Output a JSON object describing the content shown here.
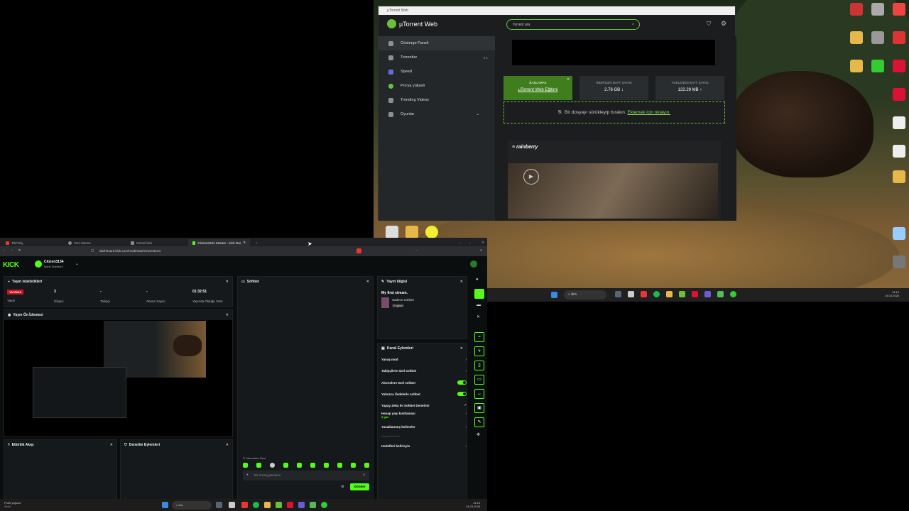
{
  "utorrent": {
    "window_title": "µTorrent Web",
    "logo": "µTorrent Web",
    "search_placeholder": "Torrent ara",
    "sidebar": [
      {
        "label": "Gösterge Paneli",
        "icon": "dashboard-icon"
      },
      {
        "label": "Torrentler",
        "icon": "torrents-icon",
        "badge": "0  1"
      },
      {
        "label": "Speed",
        "icon": "speed-icon"
      },
      {
        "label": "Pro'ya yükselt",
        "icon": "pro-icon"
      },
      {
        "label": "Trending Videos",
        "icon": "video-icon"
      },
      {
        "label": "Oyunlar",
        "icon": "games-icon"
      }
    ],
    "start_card": {
      "title": "BAŞLAMAK",
      "link": "µTorrent Web Eğitimi"
    },
    "download_card": {
      "title": "İNDİRİLEN BAYT SAYISI",
      "value": "2.76 GB ↓"
    },
    "upload_card": {
      "title": "YÜKLENEN BAYT SAYISI",
      "value": "122.29 MB ↑"
    },
    "drop_text": "Bir dosyayı sürükleyip bırakın.",
    "drop_link": "Eklemek için tıklayın.",
    "rainberry": "rainberry"
  },
  "desktop_taskbar": {
    "search": "Ara",
    "time": "14:13",
    "date": "24.03.2026"
  },
  "browser": {
    "tabs": [
      "TikFinity",
      "Yeni Sekme",
      "Görsel kick",
      "Clozen3134 Stream - Kick Dash"
    ],
    "url": "dashboard.kick.com/moderator/clozen3134"
  },
  "kick": {
    "logo": "KICK",
    "user": "Clozen3134",
    "user_role": "İçerik Direktörü",
    "stats_title": "Yayın istatistikleri",
    "stats": [
      {
        "value": "YAYINDA",
        "label": "Yayın"
      },
      {
        "value": "3",
        "label": "İzleyici"
      },
      {
        "value": "-",
        "label": "Takipçi"
      },
      {
        "value": "-",
        "label": "Abone Sayısı"
      },
      {
        "value": "01:32:51",
        "label": "Yayında Olduğu Süre"
      }
    ],
    "preview_title": "Yayın Ön İzlemesi",
    "activity_title": "Etkinlik Akışı",
    "moderation_title": "Denetim Eylemleri",
    "chat_title": "Sohbet",
    "chat_sub_label": "Abonelere Özel",
    "chat_placeholder": "Bir mesaj gönderin",
    "send_label": "Gönder",
    "info_title": "Yayın bilgisi",
    "stream_title": "My first stream.",
    "category": "Sadece Sohbet",
    "language": "English",
    "channel_title": "Kanal Eylemleri",
    "channel_actions": [
      {
        "label": "Yavaş mod",
        "type": "chevron"
      },
      {
        "label": "Takipçilere özel sohbet",
        "type": "chevron"
      },
      {
        "label": "Abonelere özel sohbet",
        "type": "toggle"
      },
      {
        "label": "Yalnızca ifadelerle sohbet",
        "type": "toggle"
      },
      {
        "label": "Yapay Zeka ile Sohbet Denetimi",
        "type": "link"
      },
      {
        "label": "Hesap yaşı kısıtlaması",
        "sub": "3 gün",
        "type": "chevron"
      },
      {
        "label": "Yasaklanmış kelimeler",
        "type": "chevron"
      },
      {
        "label": "Hedefleri belirleyin",
        "type": "chevron"
      }
    ],
    "hidden_label": "İzleyici filtreleri"
  },
  "win_taskbar": {
    "left": "Profil yoğunu",
    "left_sub": "Sesli",
    "search": "Ara",
    "time": "14:13",
    "date": "24.03.2026"
  },
  "colors": {
    "kick_green": "#53fc18",
    "ut_green": "#6bbf3a",
    "live_red": "#d0111e"
  }
}
